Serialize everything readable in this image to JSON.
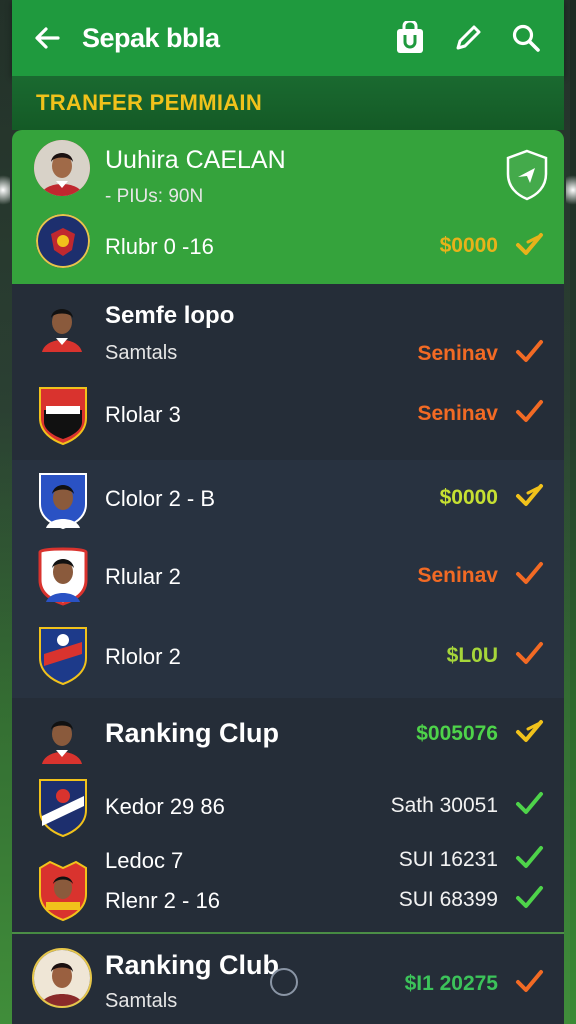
{
  "app_bar": {
    "title": "Sepak bbla"
  },
  "section": {
    "title": "TRANFER PEMMIAIN"
  },
  "featured": {
    "name": "Uuhira CAELAN",
    "subtitle": "- PIUs: 90N",
    "row_label": "Rlubr 0 -16",
    "row_value": "$0000"
  },
  "group1": {
    "name": "Semfe lopo",
    "subtitle": "Samtals",
    "subtitle_value": "Seninav",
    "row_label": "Rlolar 3",
    "row_value": "Seninav"
  },
  "group2": {
    "rows": [
      {
        "label": "Clolor 2 - B",
        "value": "$0000"
      },
      {
        "label": "Rlular 2",
        "value": "Seninav"
      },
      {
        "label": "Rlolor 2",
        "value": "$L0U"
      }
    ]
  },
  "group3": {
    "name": "Ranking Clup",
    "name_value": "$005076",
    "rows": [
      {
        "label": "Kedor 29  86",
        "value": "Sath 30051"
      },
      {
        "label": "Ledoc 7",
        "value": "SUI 16231"
      },
      {
        "label": "Rlenr 2 - 16",
        "value": "SUI 68399"
      }
    ]
  },
  "group4": {
    "name": "Ranking Club",
    "subtitle": "Samtals",
    "value": "$I1 20275"
  },
  "colors": {
    "app_bar": "#1f9a3e",
    "highlight": "#35a33c",
    "card": "#252d38",
    "orange": "#f26a24",
    "yellow": "#f1c21b",
    "green": "#4ed34a"
  }
}
